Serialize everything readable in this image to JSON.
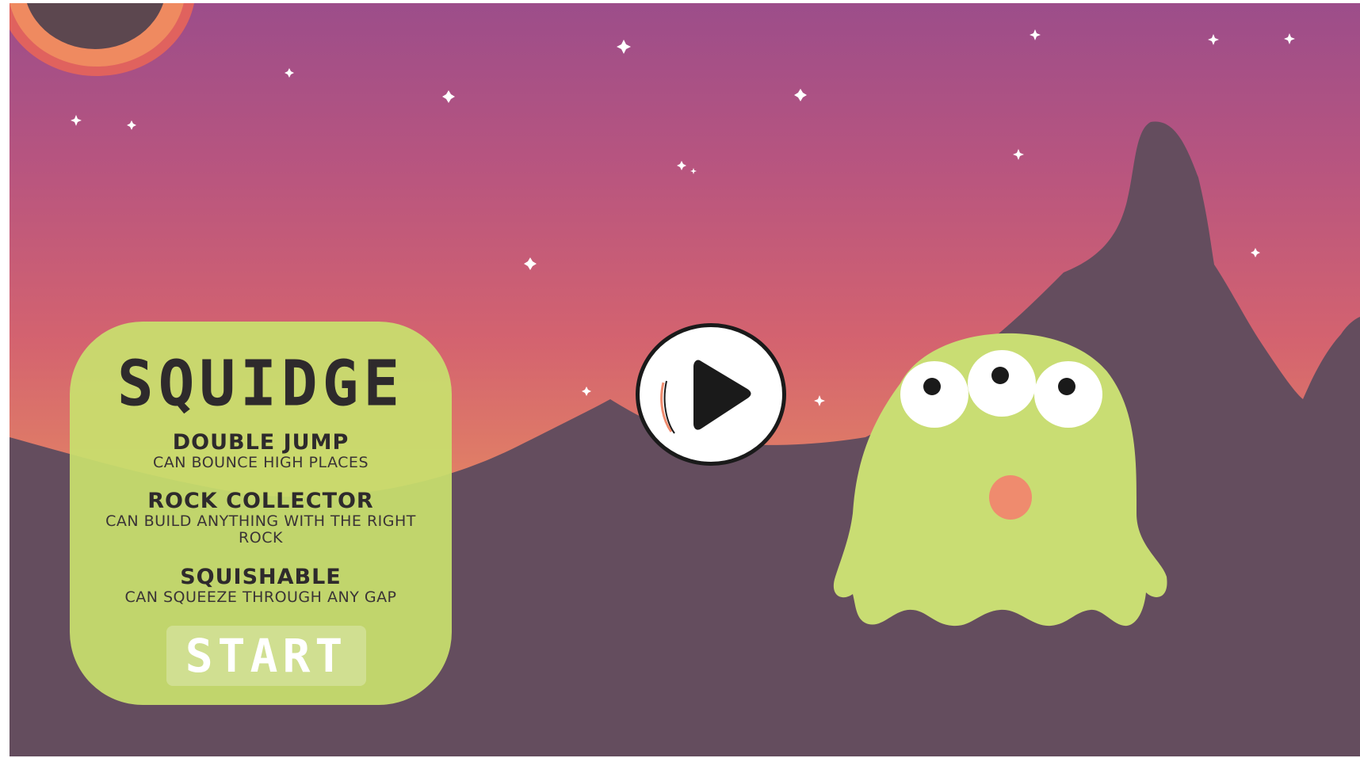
{
  "game": {
    "title": "SQUIDGE",
    "abilities": [
      {
        "name": "DOUBLE JUMP",
        "description": "CAN BOUNCE HIGH PLACES"
      },
      {
        "name": "ROCK COLLECTOR",
        "description": "CAN BUILD ANYTHING WITH THE RIGHT ROCK"
      },
      {
        "name": "SQUISHABLE",
        "description": "CAN SQUEEZE THROUGH ANY GAP"
      }
    ],
    "start_label": "START"
  },
  "icons": {
    "play": "play-icon",
    "character": "three-eyed-alien-character"
  },
  "colors": {
    "sky_top": "#9c4d8a",
    "sky_bottom": "#e7926a",
    "mountain": "#644d5e",
    "card": "#c8e06e",
    "alien": "#c9dd73",
    "alien_mouth": "#ef8b6e"
  }
}
